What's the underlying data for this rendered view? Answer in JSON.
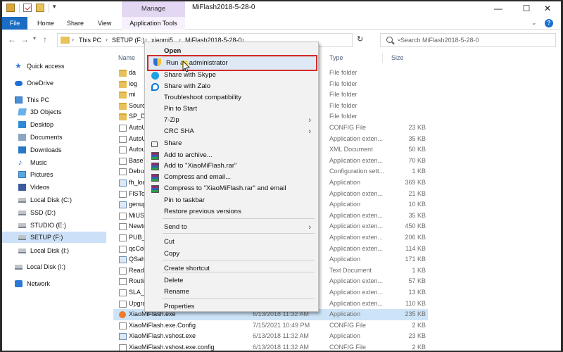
{
  "titlebar": {
    "manage_tab": "Manage",
    "title": "MiFlash2018-5-28-0",
    "minimize": "—",
    "maximize": "☐",
    "close": "✕"
  },
  "ribbon": {
    "tabs": [
      "File",
      "Home",
      "Share",
      "View",
      "Application Tools"
    ],
    "help": "?"
  },
  "address": {
    "crumbs": [
      "This PC",
      "SETUP (F:)",
      "xiaomi5",
      "MiFlash2018-5-28-0"
    ],
    "search_placeholder": "Search MiFlash2018-5-28-0"
  },
  "nav": [
    {
      "label": "Quick access",
      "icon": "star-icon"
    },
    {
      "label": "OneDrive",
      "icon": "cloud-icon"
    },
    {
      "label": "This PC",
      "icon": "computer-icon"
    },
    {
      "label": "3D Objects",
      "icon": "3d-objects-icon"
    },
    {
      "label": "Desktop",
      "icon": "desktop-icon"
    },
    {
      "label": "Documents",
      "icon": "documents-icon"
    },
    {
      "label": "Downloads",
      "icon": "downloads-icon"
    },
    {
      "label": "Music",
      "icon": "music-icon"
    },
    {
      "label": "Pictures",
      "icon": "pictures-icon"
    },
    {
      "label": "Videos",
      "icon": "videos-icon"
    },
    {
      "label": "Local Disk (C:)",
      "icon": "drive-icon"
    },
    {
      "label": "SSD (D:)",
      "icon": "drive-icon"
    },
    {
      "label": "STUDIO (E:)",
      "icon": "drive-icon"
    },
    {
      "label": "SETUP (F:)",
      "icon": "drive-icon",
      "selected": true
    },
    {
      "label": "Local Disk (I:)",
      "icon": "drive-icon"
    },
    {
      "label": "Local Disk (I:)",
      "icon": "drive-icon"
    },
    {
      "label": "Network",
      "icon": "network-icon"
    }
  ],
  "columns": {
    "name": "Name",
    "type": "Type",
    "size": "Size"
  },
  "files": [
    {
      "name": "da",
      "date": "",
      "type": "File folder",
      "size": "",
      "kind": "folder"
    },
    {
      "name": "log",
      "date": "",
      "type": "File folder",
      "size": "",
      "kind": "folder"
    },
    {
      "name": "mi",
      "date": "",
      "type": "File folder",
      "size": "",
      "kind": "folder"
    },
    {
      "name": "Sourc",
      "date": "",
      "type": "File folder",
      "size": "",
      "kind": "folder"
    },
    {
      "name": "SP_Do",
      "date": "",
      "type": "File folder",
      "size": "",
      "kind": "folder"
    },
    {
      "name": "AutoU",
      "date": "",
      "type": "CONFIG File",
      "size": "23 KB",
      "kind": "file"
    },
    {
      "name": "AutoU",
      "date": "",
      "type": "Application exten...",
      "size": "35 KB",
      "kind": "file"
    },
    {
      "name": "Autou",
      "date": "",
      "type": "XML Document",
      "size": "50 KB",
      "kind": "file"
    },
    {
      "name": "BaseT",
      "date": "",
      "type": "Application exten...",
      "size": "70 KB",
      "kind": "file"
    },
    {
      "name": "Debug",
      "date": "",
      "type": "Configuration sett...",
      "size": "1 KB",
      "kind": "file"
    },
    {
      "name": "fh_loa",
      "date": "",
      "type": "Application",
      "size": "369 KB",
      "kind": "exe"
    },
    {
      "name": "FlSToo",
      "date": "",
      "type": "Application exten...",
      "size": "21 KB",
      "kind": "file"
    },
    {
      "name": "genup",
      "date": "",
      "type": "Application",
      "size": "10 KB",
      "kind": "exe"
    },
    {
      "name": "MiUSE",
      "date": "",
      "type": "Application exten...",
      "size": "35 KB",
      "kind": "file"
    },
    {
      "name": "Newto",
      "date": "",
      "type": "Application exten...",
      "size": "450 KB",
      "kind": "file"
    },
    {
      "name": "PUB_T",
      "date": "",
      "type": "Application exten...",
      "size": "206 KB",
      "kind": "file"
    },
    {
      "name": "qcCol",
      "date": "",
      "type": "Application exten...",
      "size": "114 KB",
      "kind": "file"
    },
    {
      "name": "QSaha",
      "date": "",
      "type": "Application",
      "size": "171 KB",
      "kind": "exe"
    },
    {
      "name": "ReadM",
      "date": "",
      "type": "Text Document",
      "size": "1 KB",
      "kind": "file"
    },
    {
      "name": "Routin",
      "date": "",
      "type": "Application exten...",
      "size": "57 KB",
      "kind": "file"
    },
    {
      "name": "SLA_C",
      "date": "",
      "type": "Application exten...",
      "size": "13 KB",
      "kind": "file"
    },
    {
      "name": "Upgra",
      "date": "",
      "type": "Application exten...",
      "size": "110 KB",
      "kind": "file"
    },
    {
      "name": "XiaoMiFlash.exe",
      "date": "6/13/2018 11:32 AM",
      "type": "Application",
      "size": "235 KB",
      "kind": "miexe",
      "selected": true
    },
    {
      "name": "XiaoMiFlash.exe.Config",
      "date": "7/15/2021 10:49 PM",
      "type": "CONFIG File",
      "size": "2 KB",
      "kind": "file"
    },
    {
      "name": "XiaoMiFlash.vshost.exe",
      "date": "6/13/2018 11:32 AM",
      "type": "Application",
      "size": "23 KB",
      "kind": "exe"
    },
    {
      "name": "XiaoMiFlash.vshost.exe.config",
      "date": "6/13/2018 11:32 AM",
      "type": "CONFIG File",
      "size": "2 KB",
      "kind": "file"
    }
  ],
  "context_menu": [
    {
      "label": "Open",
      "bold": true
    },
    {
      "label": "Run as administrator",
      "icon": "shield-icon",
      "highlighted": true
    },
    {
      "label": "Share with Skype",
      "icon": "skype-icon"
    },
    {
      "label": "Share with Zalo",
      "icon": "zalo-icon"
    },
    {
      "label": "Troubleshoot compatibility"
    },
    {
      "label": "Pin to Start"
    },
    {
      "label": "7-Zip",
      "submenu": true
    },
    {
      "label": "CRC SHA",
      "submenu": true
    },
    {
      "label": "Share",
      "icon": "share-icon"
    },
    {
      "label": "Add to archive...",
      "icon": "winrar-icon"
    },
    {
      "label": "Add to \"XiaoMiFlash.rar\"",
      "icon": "winrar-icon"
    },
    {
      "label": "Compress and email...",
      "icon": "winrar-icon"
    },
    {
      "label": "Compress to \"XiaoMiFlash.rar\" and email",
      "icon": "winrar-icon"
    },
    {
      "label": "Pin to taskbar"
    },
    {
      "label": "Restore previous versions"
    },
    {
      "label": "Send to",
      "submenu": true
    },
    {
      "label": "Cut"
    },
    {
      "label": "Copy"
    },
    {
      "label": "Create shortcut"
    },
    {
      "label": "Delete"
    },
    {
      "label": "Rename"
    },
    {
      "label": "Properties"
    }
  ],
  "colors": {
    "accent": "#1a6dc2",
    "highlight_border": "#d42a2a",
    "manage_tab": "#e3d7f3"
  }
}
